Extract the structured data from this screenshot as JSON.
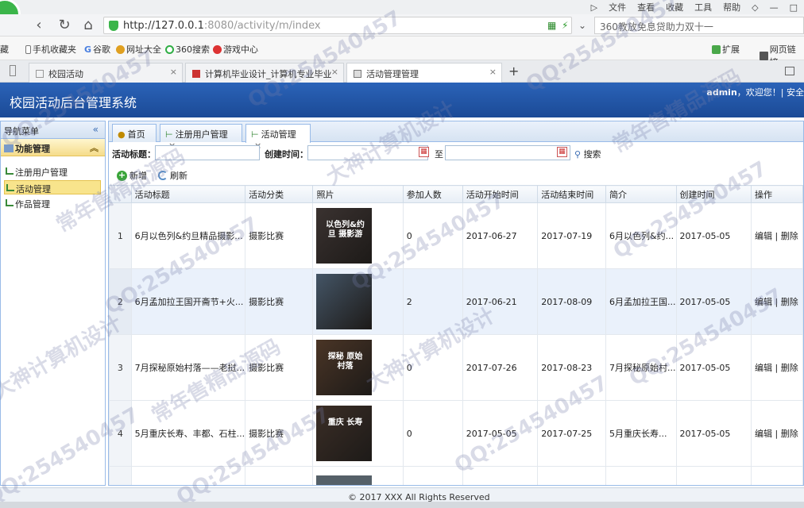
{
  "browser": {
    "menu": [
      "▷",
      "文件",
      "查看",
      "收藏",
      "工具",
      "帮助",
      "◇",
      "—",
      "□"
    ],
    "url_host": "http://127.0.0.1",
    "url_rest": ":8080/activity/m/index",
    "search_text": "360教放免息贷助力双十一",
    "bookmarks": [
      "藏",
      "手机收藏夹",
      "谷歌",
      "网址大全",
      "360搜索",
      "游戏中心"
    ],
    "bookmarks_right": [
      "扩展",
      "网页链接"
    ],
    "tabs": [
      {
        "label": "校园活动",
        "active": false
      },
      {
        "label": "计算机毕业设计_计算机专业毕业",
        "active": false
      },
      {
        "label": "活动管理管理",
        "active": true
      }
    ],
    "new_tab": "+"
  },
  "app": {
    "title": "校园活动后台管理系统",
    "user": "admin",
    "welcome": "，欢迎您！| 安全"
  },
  "sidebar": {
    "header": "导航菜单",
    "collapse": "«",
    "group": "功能管理",
    "group_collapse": "︽",
    "items": [
      {
        "label": "注册用户管理",
        "active": false
      },
      {
        "label": "活动管理",
        "active": true
      },
      {
        "label": "作品管理",
        "active": false
      }
    ]
  },
  "panel_tabs": [
    {
      "label": "首页",
      "closable": false
    },
    {
      "label": "注册用户管理",
      "closable": true
    },
    {
      "label": "活动管理",
      "closable": true
    }
  ],
  "search": {
    "title_label": "活动标题：",
    "created_label": "创建时间：",
    "to_label": "至",
    "search_button": "搜索",
    "title_value": "",
    "from_value": "",
    "to_value": ""
  },
  "toolbar": {
    "add": "新增",
    "refresh": "刷新"
  },
  "grid": {
    "columns": [
      "",
      "活动标题",
      "活动分类",
      "照片",
      "参加人数",
      "活动开始时间",
      "活动结束时间",
      "简介",
      "创建时间",
      "操作"
    ],
    "rows": [
      {
        "n": "1",
        "title": "6月以色列&约旦精品摄影...",
        "cat": "摄影比赛",
        "count": "0",
        "start": "2017-06-27",
        "end": "2017-07-19",
        "intro": "6月以色列&约...",
        "created": "2017-05-05",
        "edit": "编辑",
        "sep": " | ",
        "del": "删除",
        "photo_color": "#3a3230",
        "photo_text": "以色列&约旦 摄影游"
      },
      {
        "n": "2",
        "title": "6月孟加拉王国开斋节+火...",
        "cat": "摄影比赛",
        "count": "2",
        "start": "2017-06-21",
        "end": "2017-08-09",
        "intro": "6月孟加拉王国...",
        "created": "2017-05-05",
        "edit": "编辑",
        "sep": " | ",
        "del": "删除",
        "photo_color": "#445566",
        "photo_text": ""
      },
      {
        "n": "3",
        "title": "7月探秘原始村落——老挝...",
        "cat": "摄影比赛",
        "count": "0",
        "start": "2017-07-26",
        "end": "2017-08-23",
        "intro": "7月探秘原始村...",
        "created": "2017-05-05",
        "edit": "编辑",
        "sep": " | ",
        "del": "删除",
        "photo_color": "#4a3526",
        "photo_text": "探秘 原始村落"
      },
      {
        "n": "4",
        "title": "5月重庆长寿、丰都、石柱...",
        "cat": "摄影比赛",
        "count": "0",
        "start": "2017-05-05",
        "end": "2017-07-25",
        "intro": "5月重庆长寿...",
        "created": "2017-05-05",
        "edit": "编辑",
        "sep": " | ",
        "del": "删除",
        "photo_color": "#3b2e26",
        "photo_text": "重庆 长寿"
      }
    ]
  },
  "footer": {
    "copyright": "© 2017 XXX All Rights Reserved"
  },
  "watermarks": [
    "QQ:254540457",
    "常年售精品源码",
    "大神计算机设计"
  ]
}
